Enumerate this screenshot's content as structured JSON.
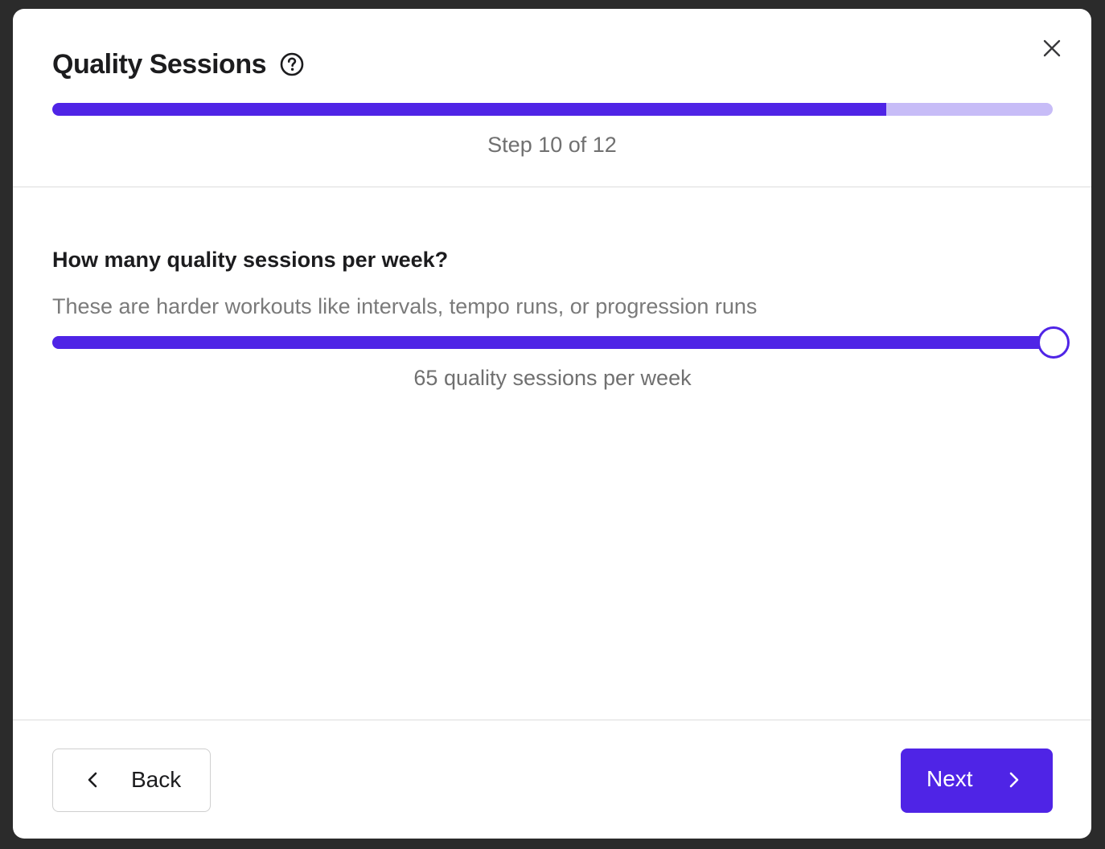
{
  "dialog": {
    "title": "Quality Sessions",
    "help_icon": "question-circle-icon",
    "close_icon": "close-icon",
    "progress": {
      "current_step": 10,
      "total_steps": 12,
      "fraction": 0.8333,
      "label": "Step 10 of 12"
    }
  },
  "question": {
    "prompt": "How many quality sessions per week?",
    "hint": "These are harder workouts like intervals, tempo runs, or progression runs"
  },
  "slider": {
    "value": 65,
    "fraction": 1.0,
    "value_label": "65 quality sessions per week"
  },
  "footer": {
    "back_label": "Back",
    "back_icon": "chevron-left-icon",
    "next_label": "Next",
    "next_icon": "chevron-right-icon"
  },
  "colors": {
    "accent": "#4f24e6",
    "accent_light": "#c7bcf7",
    "text_primary": "#1c1c1e",
    "text_secondary": "#707070"
  }
}
